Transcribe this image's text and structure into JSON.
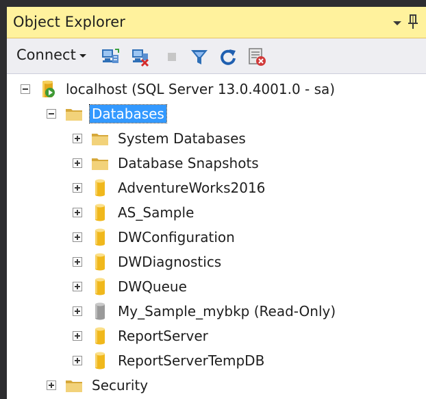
{
  "panel": {
    "title": "Object Explorer"
  },
  "toolbar": {
    "connect_label": "Connect",
    "buttons": [
      {
        "name": "connect-object-explorer-icon"
      },
      {
        "name": "disconnect-icon"
      },
      {
        "name": "stop-icon"
      },
      {
        "name": "filter-icon"
      },
      {
        "name": "refresh-icon"
      },
      {
        "name": "activity-monitor-icon"
      }
    ]
  },
  "tree": {
    "server": {
      "label": "localhost (SQL Server 13.0.4001.0 - sa)",
      "expanded": true
    },
    "databases": {
      "label": "Databases",
      "expanded": true,
      "selected": true,
      "children": [
        {
          "label": "System Databases",
          "icon": "folder-icon"
        },
        {
          "label": "Database Snapshots",
          "icon": "folder-icon"
        },
        {
          "label": "AdventureWorks2016",
          "icon": "database-icon"
        },
        {
          "label": "AS_Sample",
          "icon": "database-icon"
        },
        {
          "label": "DWConfiguration",
          "icon": "database-icon"
        },
        {
          "label": "DWDiagnostics",
          "icon": "database-icon"
        },
        {
          "label": "DWQueue",
          "icon": "database-icon"
        },
        {
          "label": "My_Sample_mybkp (Read-Only)",
          "icon": "database-readonly-icon"
        },
        {
          "label": "ReportServer",
          "icon": "database-icon"
        },
        {
          "label": "ReportServerTempDB",
          "icon": "database-icon"
        }
      ]
    },
    "security": {
      "label": "Security",
      "expanded": false
    }
  },
  "colors": {
    "titlebar": "#fff29d",
    "toolbar": "#eeeef2",
    "selection": "#3399ff",
    "database": "#f5c125",
    "folder": "#e8c35a"
  }
}
